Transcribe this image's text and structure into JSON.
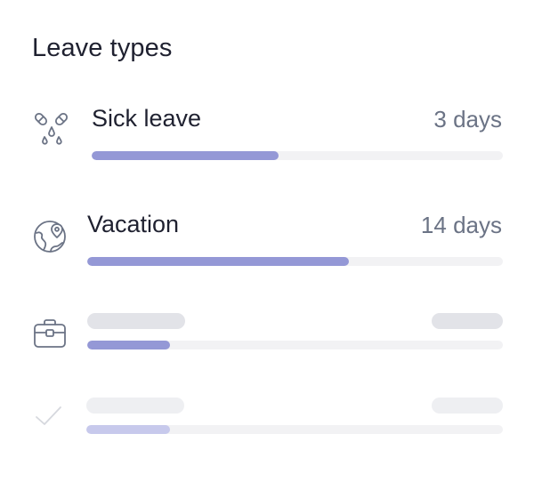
{
  "title": "Leave types",
  "accent_color": "#9498d6",
  "accent_faded_color": "#c7c9ec",
  "rows": [
    {
      "icon": "pills-icon",
      "label": "Sick leave",
      "value": "3 days",
      "progress": 0.455
    },
    {
      "icon": "globe-pin-icon",
      "label": "Vacation",
      "value": "14 days",
      "progress": 0.63
    },
    {
      "icon": "briefcase-icon",
      "label": "",
      "value": "",
      "progress": 0.2,
      "placeholder": true
    },
    {
      "icon": "check-icon",
      "label": "",
      "value": "",
      "progress": 0.2,
      "placeholder": true,
      "faded": true
    }
  ]
}
